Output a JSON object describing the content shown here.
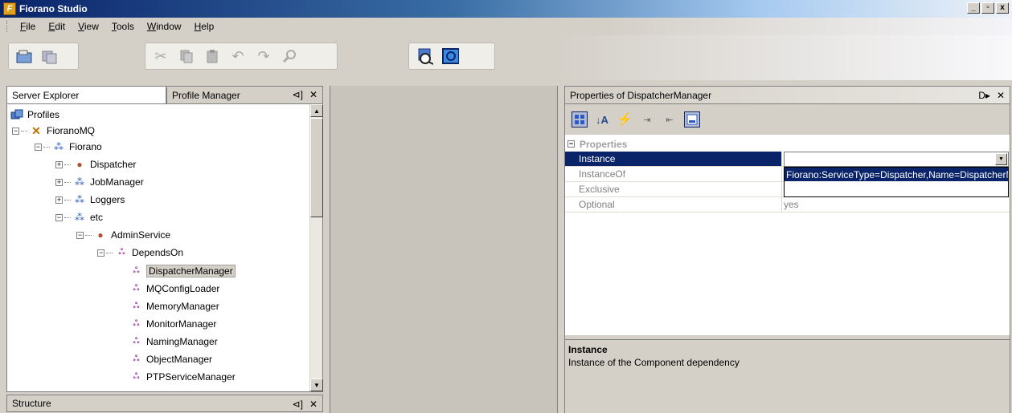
{
  "window": {
    "title": "Fiorano Studio",
    "app_icon": "F",
    "buttons": [
      "_",
      "▫",
      "x"
    ]
  },
  "menu": [
    {
      "key": "F",
      "rest": "ile"
    },
    {
      "key": "E",
      "rest": "dit"
    },
    {
      "key": "V",
      "rest": "iew"
    },
    {
      "key": "T",
      "rest": "ools"
    },
    {
      "key": "W",
      "rest": "indow"
    },
    {
      "key": "H",
      "rest": "elp"
    }
  ],
  "toolbar": {
    "group1": [
      "open-icon",
      "save-all-icon"
    ],
    "group2": [
      "cut-icon",
      "copy-icon",
      "paste-icon",
      "undo-icon",
      "redo-icon",
      "find-icon"
    ],
    "group3": [
      "connect-icon",
      "server-icon"
    ]
  },
  "left_panel": {
    "tab1": "Server Explorer",
    "tab2": "Profile Manager",
    "pin": "⊲]",
    "close": "✕",
    "tree": {
      "profiles": "Profiles",
      "fioranomq": "FioranoMQ",
      "fiorano": "Fiorano",
      "dispatcher": "Dispatcher",
      "jobmanager": "JobManager",
      "loggers": "Loggers",
      "etc": "etc",
      "adminservice": "AdminService",
      "dependson": "DependsOn",
      "deps": [
        "DispatcherManager",
        "MQConfigLoader",
        "MemoryManager",
        "MonitorManager",
        "NamingManager",
        "ObjectManager",
        "PTPServiceManager"
      ]
    }
  },
  "structure_panel": {
    "title": "Structure",
    "pin": "⊲]",
    "close": "✕"
  },
  "properties_panel": {
    "title": "Properties of DispatcherManager",
    "pin": "D▸",
    "close": "✕",
    "category": "Properties",
    "rows": [
      {
        "name": "Instance",
        "value": ""
      },
      {
        "name": "InstanceOf",
        "value": ""
      },
      {
        "name": "Exclusive",
        "value": ""
      },
      {
        "name": "Optional",
        "value": "yes"
      }
    ],
    "dropdown_options": [
      "Fiorano:ServiceType=Dispatcher,Name=DispatcherManager",
      ""
    ],
    "description_title": "Instance",
    "description_text": "Instance of the Component dependency"
  },
  "colors": {
    "selection": "#0a246a",
    "titlebar_start": "#0a246a",
    "panel_bg": "#d4d0c8"
  }
}
